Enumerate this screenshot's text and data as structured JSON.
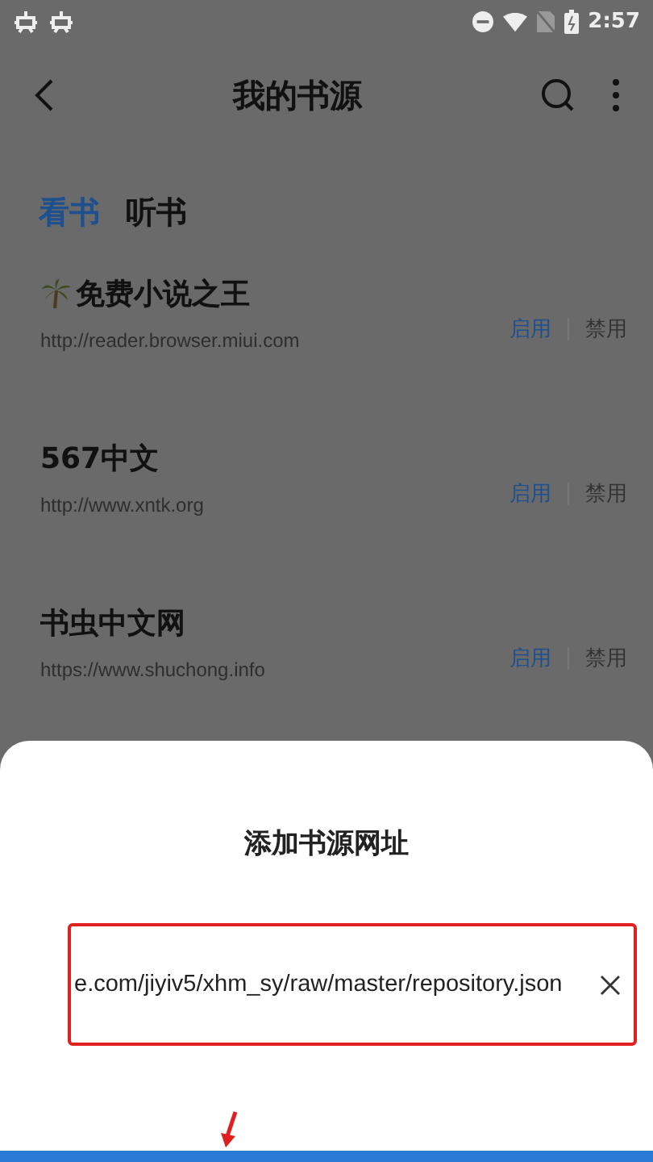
{
  "status_bar": {
    "time": "2:57"
  },
  "app_bar": {
    "title": "我的书源"
  },
  "tabs": [
    {
      "label": "看书",
      "selected": true
    },
    {
      "label": "听书",
      "selected": false
    }
  ],
  "sources": [
    {
      "kind": "icon",
      "name": "免费小说之王",
      "url": "http://reader.browser.miui.com",
      "enable_label": "启用",
      "disable_label": "禁用",
      "enabled": true
    },
    {
      "kind": "plain",
      "name": "567中文",
      "url": "http://www.xntk.org",
      "enable_label": "启用",
      "disable_label": "禁用",
      "enabled": true
    },
    {
      "kind": "plain",
      "name": "书虫中文网",
      "url": "https://www.shuchong.info",
      "enable_label": "启用",
      "disable_label": "禁用",
      "enabled": true
    }
  ],
  "dialog": {
    "title": "添加书源网址",
    "field": {
      "value": "e.com/jiyiv5/xhm_sy/raw/master/repository.json"
    }
  }
}
